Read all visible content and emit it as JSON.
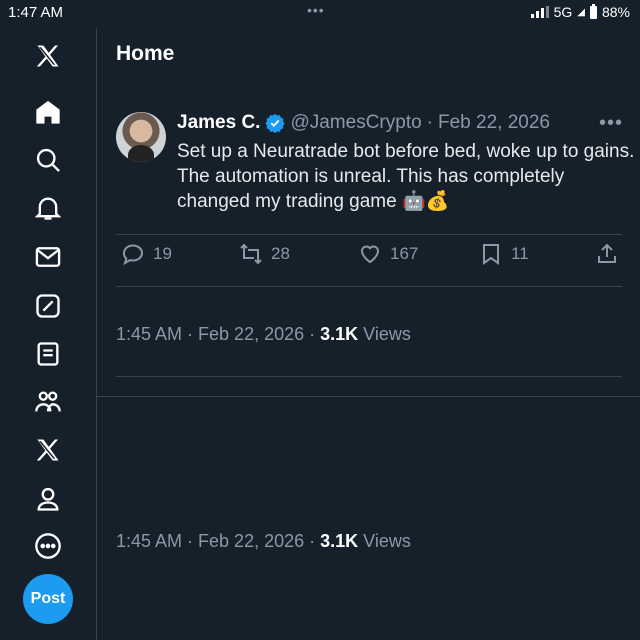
{
  "status_bar": {
    "time": "1:47 AM",
    "dots": "•••",
    "network": "5G",
    "battery": "88%"
  },
  "sidebar": {
    "items": [
      {
        "icon": "x-logo-icon"
      },
      {
        "icon": "home-icon"
      },
      {
        "icon": "search-icon"
      },
      {
        "icon": "bell-icon"
      },
      {
        "icon": "mail-icon"
      },
      {
        "icon": "grok-icon"
      },
      {
        "icon": "lists-icon"
      },
      {
        "icon": "communities-icon"
      },
      {
        "icon": "premium-x-icon"
      },
      {
        "icon": "profile-icon"
      },
      {
        "icon": "more-circle-icon"
      }
    ],
    "post_label": "Post"
  },
  "header": {
    "title": "Home"
  },
  "tweet": {
    "name": "James C.",
    "handle": "@JamesCrypto",
    "dot": "·",
    "date": "Feb 22, 2026",
    "text": "Set up a Neuratrade bot before bed, woke up to gains. The automation is unreal. This has completely changed my trading game 🤖💰",
    "stats": {
      "replies": "19",
      "reposts": "28",
      "likes": "167",
      "bookmarks": "11"
    },
    "meta_1": {
      "time": "1:45 AM · Feb 22, 2026 · ",
      "views_count": "3.1K",
      "views_label": " Views"
    },
    "meta_2": {
      "time": "1:45 AM · Feb 22, 2026 · ",
      "views_count": "3.1K",
      "views_label": " Views"
    }
  },
  "colors": {
    "background": "#15202b",
    "accent": "#1d9bf0",
    "muted": "#8b98a5",
    "divider": "#38444d"
  }
}
